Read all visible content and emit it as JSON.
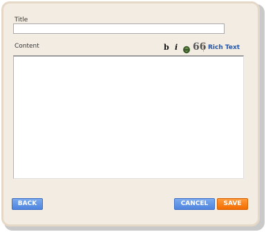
{
  "form": {
    "title_label": "Title",
    "title_value": "",
    "content_label": "Content",
    "content_value": ""
  },
  "toolbar": {
    "bold_label": "b",
    "italic_label": "i",
    "link_icon": "link-icon",
    "quote_label": "66",
    "rich_text_label": "Rich Text"
  },
  "buttons": {
    "back_label": "BACK",
    "cancel_label": "CANCEL",
    "save_label": "SAVE"
  },
  "colors": {
    "panel_bg": "#f3ece2",
    "panel_border": "#e6d8c6",
    "blue_button": "#5b8fe3",
    "orange_button": "#f57a10",
    "link_text": "#2255aa"
  }
}
